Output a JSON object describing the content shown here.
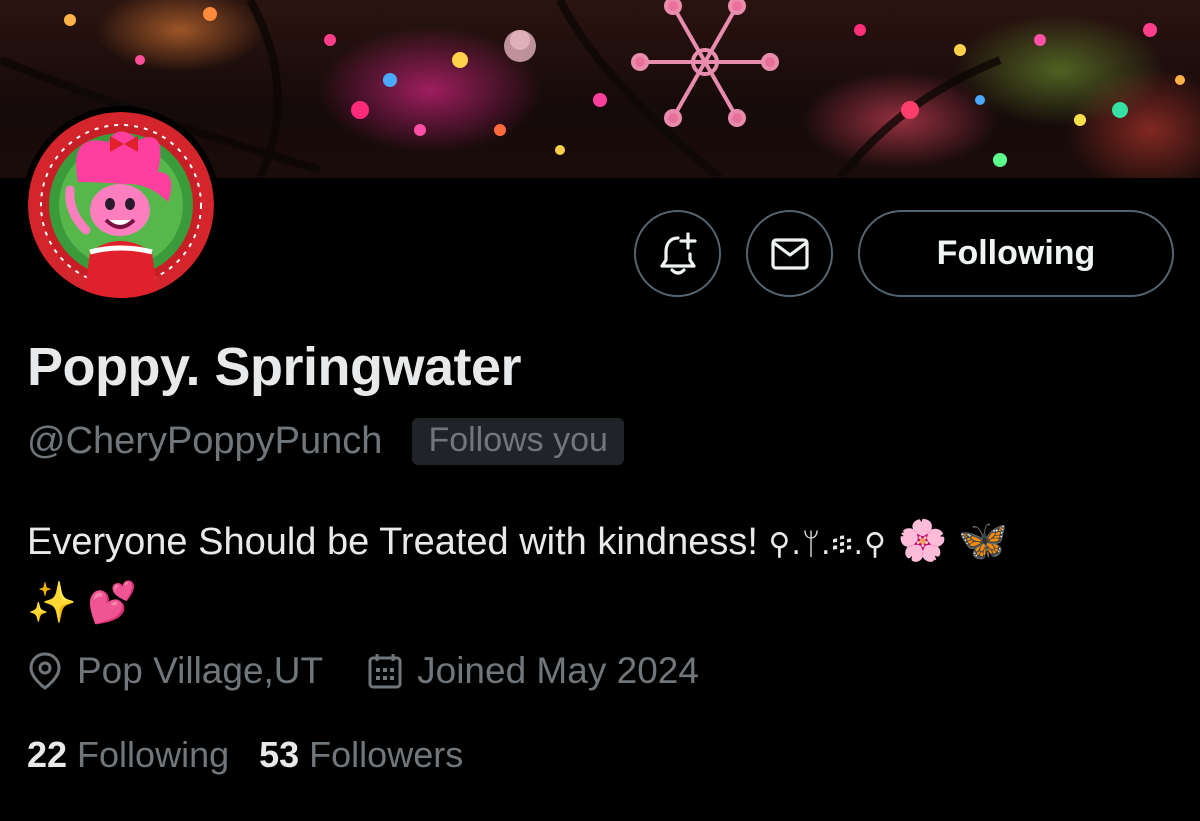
{
  "banner": {
    "image": "christmas-lights-ornament"
  },
  "avatar": {
    "image": "poppy-troll-christmas",
    "colors": {
      "ring": "#d4252c",
      "inner": "#3a9b3a",
      "hair": "#ff3fa0"
    }
  },
  "actions": {
    "notify_icon": "bell-plus-icon",
    "message_icon": "envelope-icon",
    "following_label": "Following"
  },
  "profile": {
    "display_name": "Poppy. Springwater",
    "handle": "@CheryPoppyPunch",
    "follows_you": "Follows you",
    "bio_text": "Everyone Should be Treated with kindness!",
    "bio_symbols": "⚲.ᛘ.፨.⚲",
    "bio_emoji_1": "🌸",
    "bio_emoji_2": "🦋",
    "bio_emoji_3": "✨",
    "bio_emoji_4": "💕",
    "location_icon": "location-pin-icon",
    "location": "Pop Village,UT",
    "joined_icon": "calendar-icon",
    "joined": "Joined May 2024"
  },
  "stats": {
    "following_count": "22",
    "following_label": "Following",
    "followers_count": "53",
    "followers_label": "Followers"
  },
  "colors": {
    "background": "#000000",
    "primary_text": "#e7e9ea",
    "secondary_text": "#71767b",
    "border": "#536471",
    "badge_bg": "#202327"
  }
}
